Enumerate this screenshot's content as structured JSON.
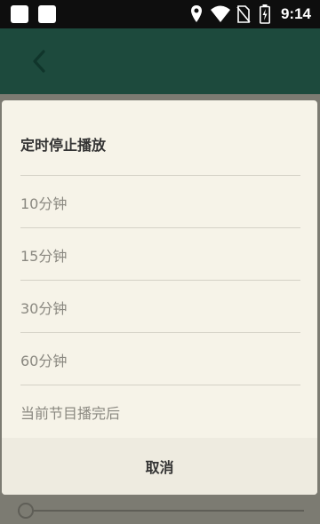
{
  "status_bar": {
    "time": "9:14",
    "icons": [
      "notification-icon",
      "notification-icon",
      "location-icon",
      "wifi-icon",
      "no-sim-icon",
      "battery-charging-icon"
    ]
  },
  "header": {
    "back_icon": "chevron-left-icon"
  },
  "dialog": {
    "title": "定时停止播放",
    "options": [
      {
        "label": "10分钟"
      },
      {
        "label": "15分钟"
      },
      {
        "label": "30分钟"
      },
      {
        "label": "60分钟"
      },
      {
        "label": "当前节目播完后"
      }
    ],
    "cancel_label": "取消"
  },
  "colors": {
    "header": "#1d4a3d",
    "dialog_bg": "#f6f3e8",
    "cancel_bg": "#eeebe0",
    "option_text": "#8a8880",
    "title_text": "#333333"
  }
}
